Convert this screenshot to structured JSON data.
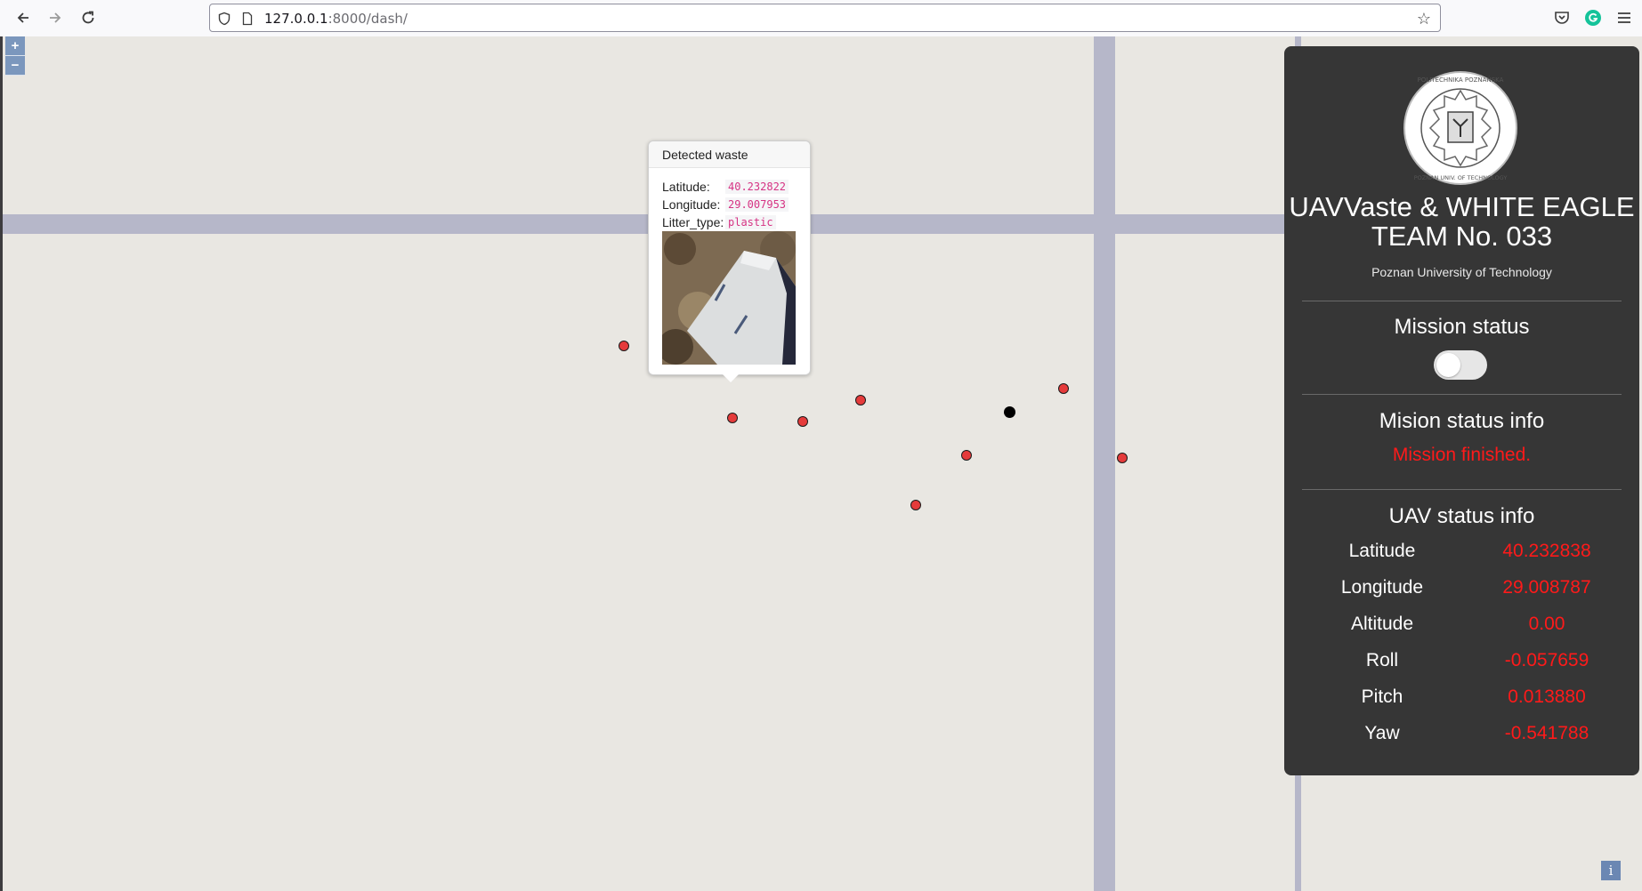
{
  "browser": {
    "url_host": "127.0.0.1",
    "url_path": ":8000/dash/"
  },
  "map": {
    "zoom_in_label": "+",
    "zoom_out_label": "−",
    "attribution_label": "i"
  },
  "popup": {
    "title": "Detected waste",
    "latitude_label": "Latitude:",
    "latitude_value": "40.232822",
    "longitude_label": "Longitude:",
    "longitude_value": "29.007953",
    "litter_type_label": "Litter_type:",
    "litter_type_value": "plastic"
  },
  "panel": {
    "team_name": "UAVVaste & WHITE EAGLE TEAM No. 033",
    "university": "Poznan University of Technology",
    "logo_text": "POLITECHNIKA POZNAŃSKA · POZNAN UNIVERSITY OF TECHNOLOGY",
    "mission_status_title": "Mission status",
    "mission_status_on": false,
    "mission_info_title": "Mision status info",
    "mission_info_text": "Mission finished.",
    "uav_info_title": "UAV status info",
    "stats": [
      {
        "label": "Latitude",
        "value": "40.232838"
      },
      {
        "label": "Longitude",
        "value": "29.008787"
      },
      {
        "label": "Altitude",
        "value": "0.00"
      },
      {
        "label": "Roll",
        "value": "-0.057659"
      },
      {
        "label": "Pitch",
        "value": "0.013880"
      },
      {
        "label": "Yaw",
        "value": "-0.541788"
      }
    ]
  },
  "colors": {
    "map_bg": "#e9e7e2",
    "road": "#b6b7c9",
    "marker": "#e53b3b",
    "uav_marker": "#000000",
    "panel_bg": "#363636",
    "alert_text": "#ff1a1a"
  }
}
